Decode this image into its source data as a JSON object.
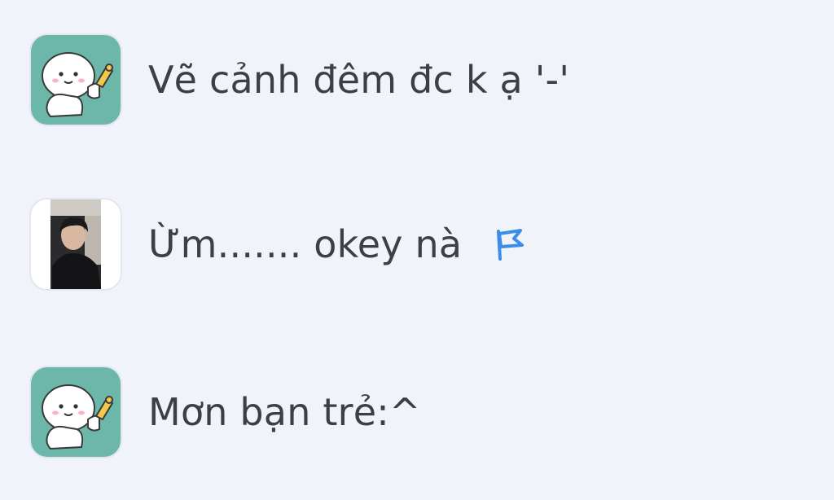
{
  "colors": {
    "background": "#f0f3f9",
    "text": "#3c3f44",
    "flag": "#3b8ee8",
    "sticker_bg": "#6cb7a9"
  },
  "messages": [
    {
      "author_avatar": "sticker-avatar-icon",
      "text": "Vẽ cảnh đêm đc k ạ '-'"
    },
    {
      "author_avatar": "photo-avatar",
      "text": "Ừm....... okey nà",
      "action_icon": "flag-icon"
    },
    {
      "author_avatar": "sticker-avatar-icon",
      "text": "Mơn bạn trẻ:^"
    }
  ]
}
